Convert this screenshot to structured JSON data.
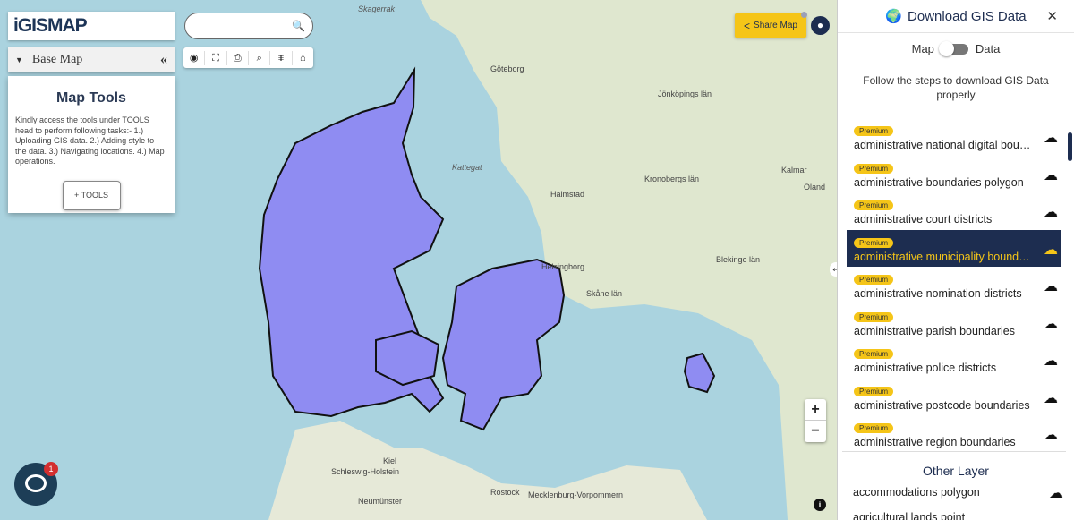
{
  "app": {
    "logo": "iGISMAP"
  },
  "sidebar": {
    "basemap_label": "Base Map",
    "tools_title": "Map Tools",
    "tools_text": "Kindly access the tools under TOOLS head to perform following tasks:- 1.) Uploading GIS data. 2.) Adding style to the data. 3.) Navigating locations. 4.) Map operations.",
    "tools_button": "+ TOOLS"
  },
  "search": {
    "placeholder": "",
    "value": ""
  },
  "toolbar": {
    "icons": [
      "locate-icon",
      "fullscreen-icon",
      "print-icon",
      "zoom-search-icon",
      "measure-icon",
      "home-icon"
    ]
  },
  "share": {
    "label": "Share Map"
  },
  "map": {
    "labels": [
      {
        "text": "Skagerrak",
        "cls": ""
      },
      {
        "text": "Göteborg",
        "cls": "land"
      },
      {
        "text": "Halmstad",
        "cls": "land"
      },
      {
        "text": "Kattegat",
        "cls": ""
      },
      {
        "text": "Jönköpings län",
        "cls": "land"
      },
      {
        "text": "Kronobergs län",
        "cls": "land"
      },
      {
        "text": "Kalmar",
        "cls": "land"
      },
      {
        "text": "Skåne län",
        "cls": "land"
      },
      {
        "text": "Helsingborg",
        "cls": "land"
      },
      {
        "text": "Blekinge län",
        "cls": "land"
      },
      {
        "text": "Kiel",
        "cls": "land"
      },
      {
        "text": "Schleswig-Holstein",
        "cls": "land"
      },
      {
        "text": "Rostock",
        "cls": "land"
      },
      {
        "text": "Mecklenburg-Vorpommern",
        "cls": "land"
      },
      {
        "text": "Neumünster",
        "cls": "land"
      },
      {
        "text": "Öland",
        "cls": "land"
      }
    ],
    "zoom_in": "+",
    "zoom_out": "−",
    "info": "i",
    "colors": {
      "water": "#aad3df",
      "land": "#dfe7cf",
      "denmark": "#8f8cf2"
    }
  },
  "chat": {
    "badge": "1"
  },
  "panel": {
    "title": "Download GIS Data",
    "toggle_left": "Map",
    "toggle_right": "Data",
    "steps": "Follow the steps to download GIS Data properly",
    "premium_label": "Premium",
    "items": [
      {
        "name": "administrative national digital boundaries",
        "active": false
      },
      {
        "name": "administrative boundaries polygon",
        "active": false
      },
      {
        "name": "administrative court districts",
        "active": false
      },
      {
        "name": "administrative municipality boundaries",
        "active": true
      },
      {
        "name": "administrative nomination districts",
        "active": false
      },
      {
        "name": "administrative parish boundaries",
        "active": false
      },
      {
        "name": "administrative police districts",
        "active": false
      },
      {
        "name": "administrative postcode boundaries",
        "active": false
      },
      {
        "name": "administrative region boundaries",
        "active": false
      }
    ],
    "other_title": "Other Layer",
    "other_items": [
      "accommodations polygon",
      "agricultural lands point"
    ]
  }
}
